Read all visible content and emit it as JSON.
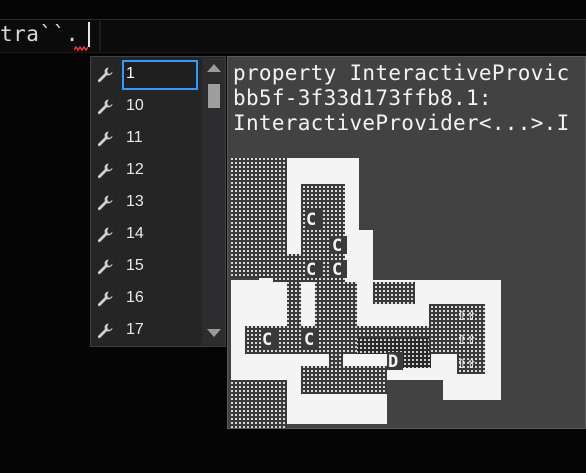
{
  "editor": {
    "code_text": "tra``.",
    "squiggle_color": "#e03c3c"
  },
  "completion": {
    "selected_index": 0,
    "items": [
      "1",
      "10",
      "11",
      "12",
      "13",
      "14",
      "15",
      "16",
      "17"
    ],
    "icon": "wrench-icon",
    "selection_color": "#3399ff"
  },
  "tooltip": {
    "lines": [
      "property InteractiveProvic",
      "bb5f-3f33d173ffb8.1:",
      "InteractiveProvider<...>.I"
    ],
    "map_markers": {
      "c": "C",
      "d": "D",
      "arrows": "⇧⇧"
    }
  }
}
